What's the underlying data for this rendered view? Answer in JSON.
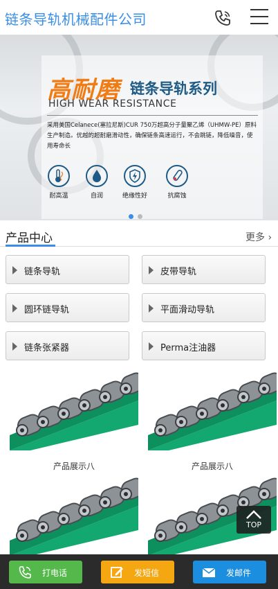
{
  "header": {
    "title": "链条导轨机械配件公司"
  },
  "banner": {
    "title_main": "高耐磨",
    "title_series": "链条导轨系列",
    "subtitle": "HIGH WEAR RESISTANCE",
    "description": "采用美国Celanece(塞拉尼斯)CUR 750万超高分子量聚乙烯（UHMW-PE）原料生产制造。优越的超耐磨滑动性，确保链条高速运行，不会跳链，降低噪音，使用寿命长",
    "features": [
      "耐高温",
      "自润",
      "绝缘性好",
      "抗腐蚀"
    ],
    "slides": 2,
    "active_slide": 1
  },
  "products_section": {
    "title": "产品中心",
    "more": "更多",
    "categories": [
      "链条导轨",
      "皮带导轨",
      "圆环链导轨",
      "平面滑动导轨",
      "链条张紧器",
      "Perma注油器"
    ],
    "items": [
      {
        "name": "产品展示八"
      },
      {
        "name": "产品展示八"
      },
      {
        "name": ""
      },
      {
        "name": ""
      }
    ]
  },
  "back_to_top": "TOP",
  "footer": {
    "call": "打电话",
    "sms": "发短信",
    "email": "发邮件"
  },
  "colors": {
    "accent": "#3a8ee6",
    "call": "#55b84b",
    "sms": "#f4a711",
    "email": "#1c8ee0",
    "guide_green": "#12a870"
  }
}
